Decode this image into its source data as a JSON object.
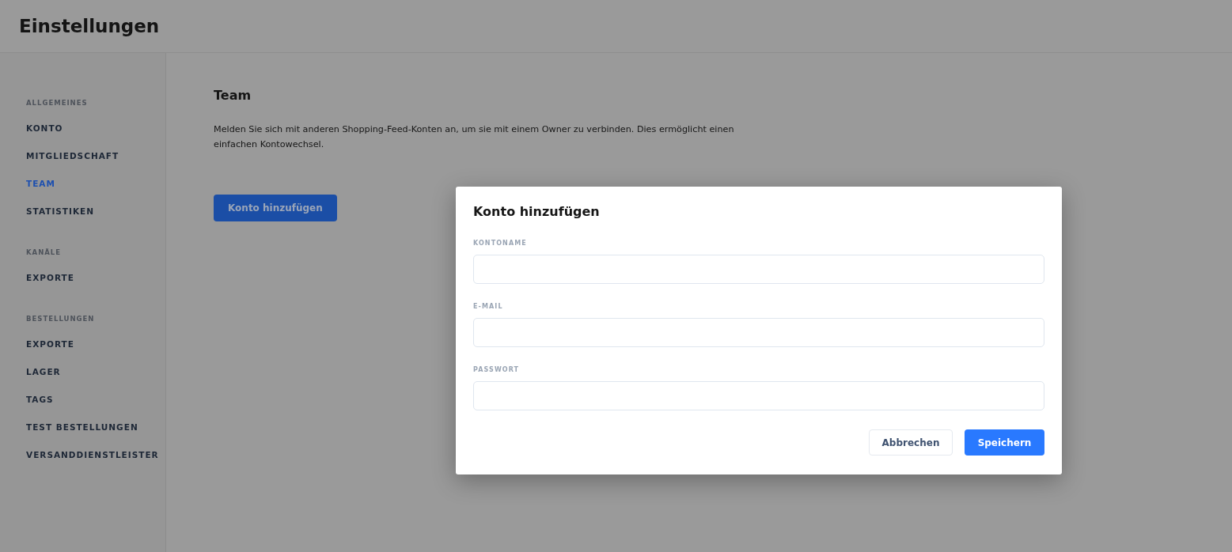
{
  "header": {
    "title": "Einstellungen"
  },
  "sidebar": {
    "sections": [
      {
        "label": "ALLGEMEINES",
        "items": [
          {
            "label": "KONTO",
            "selected": false
          },
          {
            "label": "MITGLIEDSCHAFT",
            "selected": false
          },
          {
            "label": "TEAM",
            "selected": true
          },
          {
            "label": "STATISTIKEN",
            "selected": false
          }
        ]
      },
      {
        "label": "KANÄLE",
        "items": [
          {
            "label": "EXPORTE",
            "selected": false
          }
        ]
      },
      {
        "label": "BESTELLUNGEN",
        "items": [
          {
            "label": "EXPORTE",
            "selected": false
          },
          {
            "label": "LAGER",
            "selected": false
          },
          {
            "label": "TAGS",
            "selected": false
          },
          {
            "label": "TEST BESTELLUNGEN",
            "selected": false
          },
          {
            "label": "VERSANDDIENSTLEISTER",
            "selected": false
          }
        ]
      }
    ]
  },
  "content": {
    "title": "Team",
    "description": "Melden Sie sich mit anderen Shopping-Feed-Konten an, um sie mit einem Owner zu verbinden. Dies ermöglicht einen einfachen Kontowechsel.",
    "button": "Konto hinzufügen"
  },
  "dialog": {
    "title": "Konto hinzufügen",
    "fields": [
      {
        "label": "KONTONAME"
      },
      {
        "label": "E-MAIL"
      },
      {
        "label": "PASSWORT"
      }
    ],
    "cancel": "Abbrechen",
    "save": "Speichern"
  }
}
